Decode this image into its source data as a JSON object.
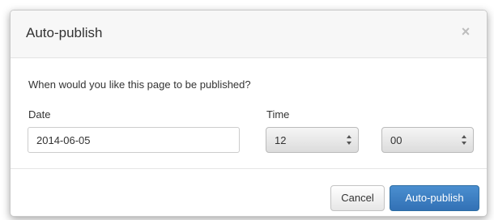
{
  "dialog": {
    "title": "Auto-publish",
    "close_glyph": "×"
  },
  "form": {
    "question": "When would you like this page to be published?",
    "date_label": "Date",
    "date_value": "2014-06-05",
    "time_label": "Time",
    "hour_value": "12",
    "minute_value": "00"
  },
  "footer": {
    "cancel_label": "Cancel",
    "submit_label": "Auto-publish"
  },
  "colors": {
    "primary": "#3a7fc1",
    "header_bg": "#f7f7f7"
  },
  "icons": {
    "close": "close-icon",
    "select_arrows": "up-down-arrows-icon"
  }
}
